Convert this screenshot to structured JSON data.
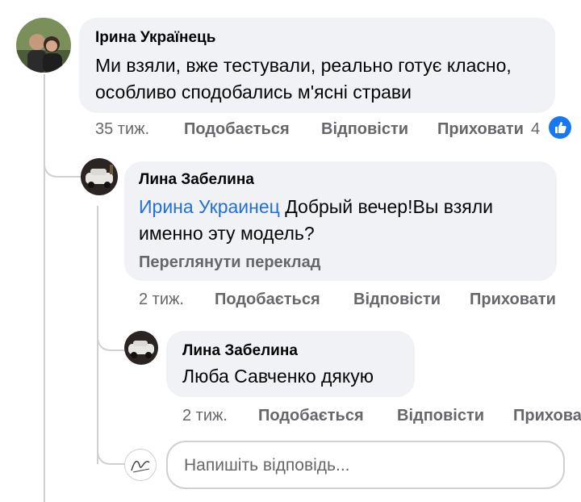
{
  "comments": [
    {
      "author": "Ірина Українець",
      "text": "Ми взяли, вже тестували, реально готує класно, особливо сподобались м'ясні страви",
      "time": "35 тиж.",
      "like": "Подобається",
      "reply": "Відповісти",
      "hide": "Приховати",
      "reaction_count": "4",
      "liked": true
    },
    {
      "author": "Лина Забелина",
      "mention": "Ирина Украинец",
      "text": "Добрый вечер!Вы взяли именно эту модель?",
      "translate": "Переглянути переклад",
      "time": "2 тиж.",
      "like": "Подобається",
      "reply": "Відповісти",
      "hide": "Приховати"
    },
    {
      "author": "Лина Забелина",
      "text": "Люба Савченко дякую",
      "time": "2 тиж.",
      "like": "Подобається",
      "reply": "Відповісти",
      "hide": "Прихова"
    }
  ],
  "reply_box": {
    "placeholder": "Напишіть відповідь..."
  },
  "colors": {
    "link": "#216fdb",
    "bubble": "#f0f2f5",
    "meta": "#65676b"
  }
}
